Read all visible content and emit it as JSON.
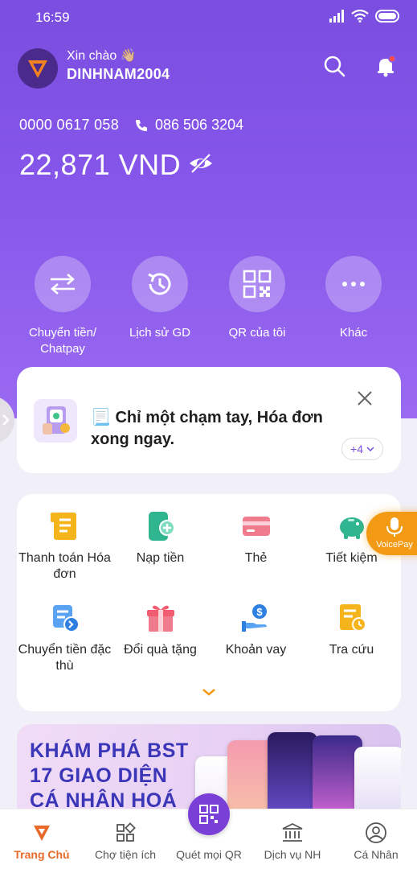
{
  "status_bar": {
    "time": "16:59"
  },
  "header": {
    "greeting": "Xin chào 👋🏼",
    "username": "DINHNAM2004"
  },
  "account": {
    "number": "0000 0617 058",
    "phone": "086 506 3204",
    "balance": "22,871 VND"
  },
  "quick_actions": [
    {
      "label": "Chuyển tiền/ Chatpay",
      "icon": "transfer-icon"
    },
    {
      "label": "Lịch sử GD",
      "icon": "history-icon"
    },
    {
      "label": "QR của tôi",
      "icon": "qr-icon"
    },
    {
      "label": "Khác",
      "icon": "more-icon"
    }
  ],
  "banner": {
    "text": "📃 Chỉ một chạm tay, Hóa đơn xong ngay.",
    "more": "+4"
  },
  "services": [
    {
      "label": "Thanh toán Hóa đơn",
      "icon": "bill-icon"
    },
    {
      "label": "Nạp tiền",
      "icon": "topup-icon"
    },
    {
      "label": "Thẻ",
      "icon": "card-icon"
    },
    {
      "label": "Tiết kiệm",
      "icon": "piggy-bank-icon"
    },
    {
      "label": "Chuyển tiền đặc thù",
      "icon": "special-transfer-icon"
    },
    {
      "label": "Đổi quà tặng",
      "icon": "gift-icon"
    },
    {
      "label": "Khoản vay",
      "icon": "loan-icon"
    },
    {
      "label": "Tra cứu",
      "icon": "lookup-icon"
    }
  ],
  "voicepay": {
    "label": "VoicePay"
  },
  "promo": {
    "line1": "KHÁM PHÁ BST",
    "line2": "17 GIAO DIỆN",
    "line3": "CÁ NHÂN HOÁ"
  },
  "bottom_nav": [
    {
      "label": "Trang Chủ",
      "icon": "home-icon",
      "active": true
    },
    {
      "label": "Chợ tiện ích",
      "icon": "apps-icon"
    },
    {
      "label": "Quét mọi QR",
      "icon": "scan-qr-icon"
    },
    {
      "label": "Dịch vụ NH",
      "icon": "bank-icon"
    },
    {
      "label": "Cá Nhân",
      "icon": "profile-icon"
    }
  ],
  "colors": {
    "primary": "#7a4ee0",
    "accent": "#e8692a",
    "voicepay": "#f29a14"
  }
}
